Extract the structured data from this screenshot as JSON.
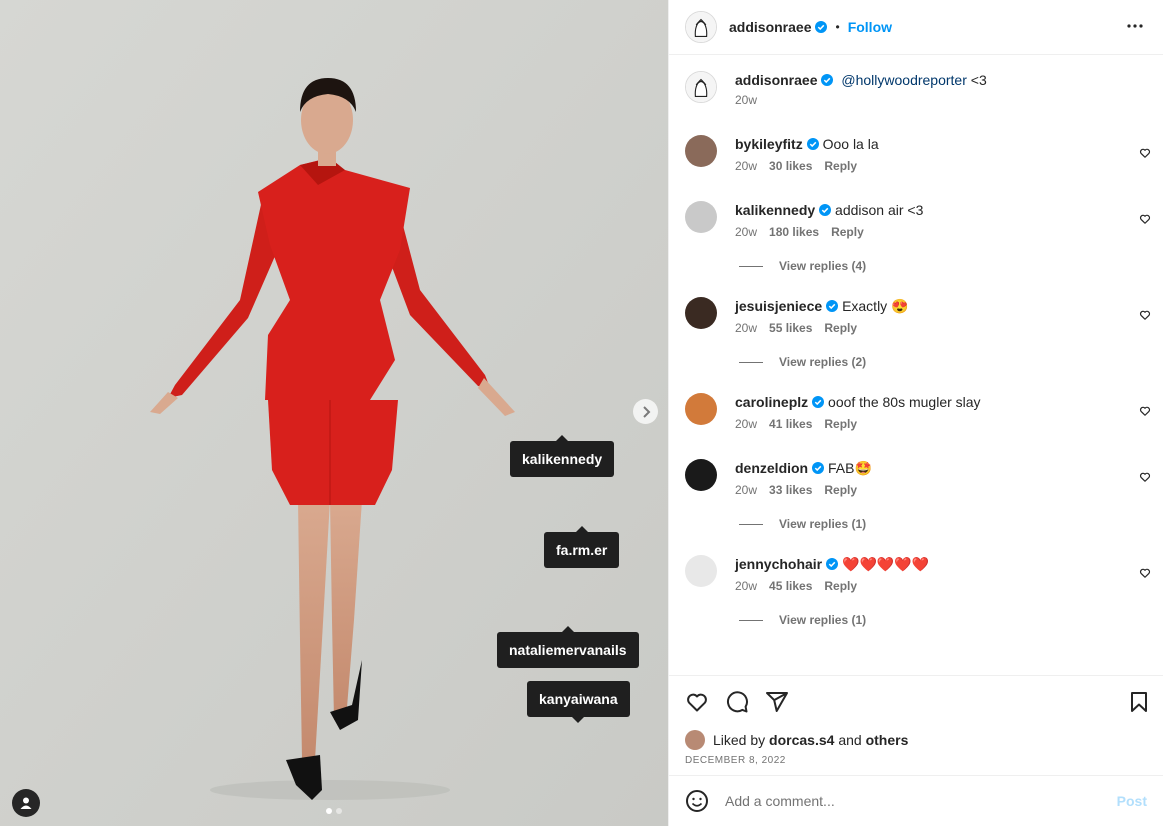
{
  "post": {
    "author": "addisonraee",
    "follow_label": "Follow",
    "bullet": "•",
    "caption_mention": "@hollywoodreporter",
    "caption_text": " <3",
    "caption_time": "20w"
  },
  "tags": [
    "kalikennedy",
    "fa.rm.er",
    "nataliemervanails",
    "kanyaiwana"
  ],
  "comments": [
    {
      "user": "bykileyfitz",
      "text": "Ooo la la",
      "time": "20w",
      "likes": "30 likes",
      "reply": "Reply",
      "replies": null,
      "avatar_color": "#8a6a5a"
    },
    {
      "user": "kalikennedy",
      "text": "addison air <3",
      "time": "20w",
      "likes": "180 likes",
      "reply": "Reply",
      "replies": "View replies (4)",
      "avatar_color": "#c9c9c9"
    },
    {
      "user": "jesuisjeniece",
      "text": "Exactly 😍",
      "time": "20w",
      "likes": "55 likes",
      "reply": "Reply",
      "replies": "View replies (2)",
      "avatar_color": "#3a2a22"
    },
    {
      "user": "carolineplz",
      "text": "ooof the 80s mugler slay",
      "time": "20w",
      "likes": "41 likes",
      "reply": "Reply",
      "replies": null,
      "avatar_color": "#d27a3a"
    },
    {
      "user": "denzeldion",
      "text": "FAB🤩",
      "time": "20w",
      "likes": "33 likes",
      "reply": "Reply",
      "replies": "View replies (1)",
      "avatar_color": "#1a1a1a"
    },
    {
      "user": "jennychohair",
      "text": "❤️❤️❤️❤️❤️",
      "time": "20w",
      "likes": "45 likes",
      "reply": "Reply",
      "replies": "View replies (1)",
      "avatar_color": "#e8e8e8"
    }
  ],
  "likes": {
    "prefix": "Liked by ",
    "user": "dorcas.s4",
    "middle": " and ",
    "others": "others"
  },
  "date": "DECEMBER 8, 2022",
  "add_comment": {
    "placeholder": "Add a comment...",
    "post_label": "Post"
  },
  "icons": {
    "verified": "verified-badge-icon",
    "more": "more-options-icon",
    "heart": "heart-icon",
    "comment": "comment-icon",
    "share": "share-icon",
    "save": "bookmark-icon",
    "emoji": "emoji-icon",
    "next": "chevron-right-icon",
    "user": "user-tag-icon"
  },
  "colors": {
    "accent": "#0095f6",
    "verified": "#0095f6",
    "dress": "#d8201c"
  }
}
